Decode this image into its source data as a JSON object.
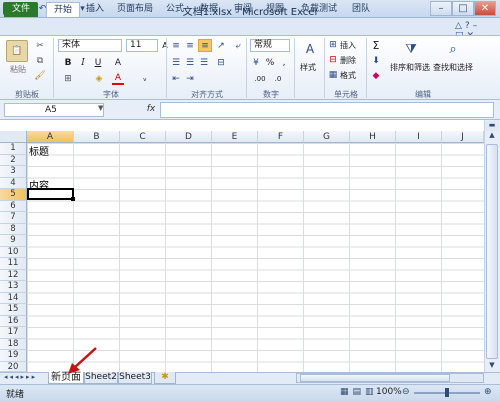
{
  "window": {
    "title": "文档1.xlsx - Microsoft Excel"
  },
  "tabs": [
    "文件",
    "开始",
    "插入",
    "页面布局",
    "公式",
    "数据",
    "审阅",
    "视图",
    "负载测试",
    "团队"
  ],
  "ribbon": {
    "paste_label": "粘贴",
    "font_name": "宋体",
    "font_size": "11",
    "number_format": "常规",
    "style_label": "样式",
    "insert_label": "插入",
    "delete_label": "删除",
    "format_label": "格式",
    "sort_filter_label": "排序和筛选",
    "find_select_label": "查找和选择",
    "groups": [
      "剪贴板",
      "字体",
      "对齐方式",
      "数字",
      "单元格",
      "编辑"
    ]
  },
  "formula_bar": {
    "name_box": "A5",
    "fx": "fx",
    "value": ""
  },
  "columns": [
    "A",
    "B",
    "C",
    "D",
    "E",
    "F",
    "G",
    "H",
    "I",
    "J"
  ],
  "rows": [
    "1",
    "2",
    "3",
    "4",
    "5",
    "6",
    "7",
    "8",
    "9",
    "10",
    "11",
    "12",
    "13",
    "14",
    "15",
    "16",
    "17",
    "18",
    "19",
    "20"
  ],
  "cells": {
    "A1": "标题",
    "A4": "内容"
  },
  "sheets": [
    "新页面",
    "Sheet2",
    "Sheet3"
  ],
  "status": {
    "ready": "就绪",
    "zoom": "100%"
  }
}
